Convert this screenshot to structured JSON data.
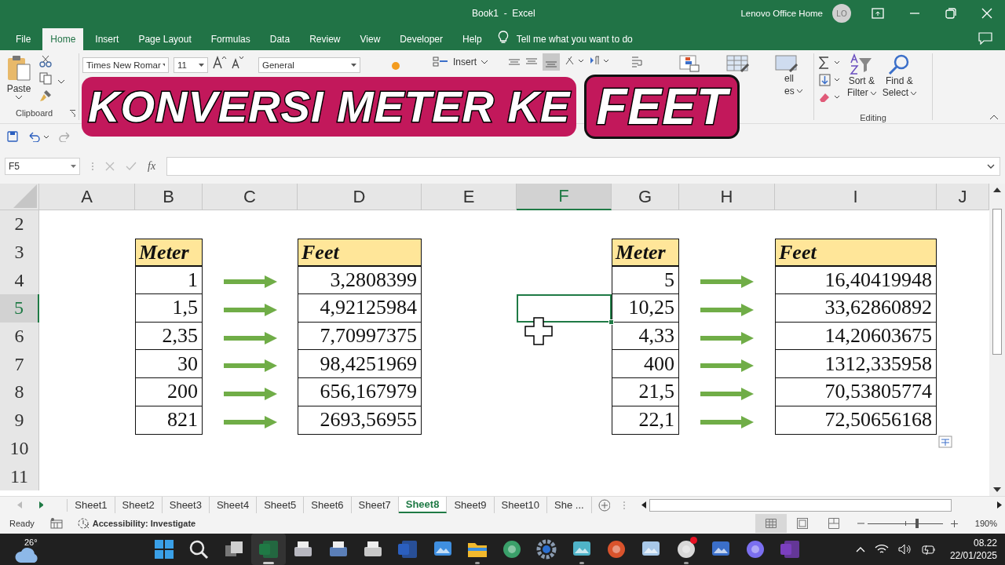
{
  "window": {
    "title": "Book1  -  Excel",
    "account": "Lenovo Office Home",
    "avatar": "LO"
  },
  "ribbon_tabs": [
    {
      "label": "File",
      "selected": false
    },
    {
      "label": "Home",
      "selected": true
    },
    {
      "label": "Insert",
      "selected": false
    },
    {
      "label": "Page Layout",
      "selected": false
    },
    {
      "label": "Formulas",
      "selected": false
    },
    {
      "label": "Data",
      "selected": false
    },
    {
      "label": "Review",
      "selected": false
    },
    {
      "label": "View",
      "selected": false
    },
    {
      "label": "Developer",
      "selected": false
    },
    {
      "label": "Help",
      "selected": false
    }
  ],
  "tell_me": {
    "placeholder": "Tell me what you want to do"
  },
  "ribbon": {
    "paste": "Paste",
    "clipboard_group": "Clipboard",
    "font_name": "Times New Romar",
    "font_size": "11",
    "number_format": "General",
    "insert": "Insert",
    "cell_styles_partial": [
      "ell",
      "es"
    ],
    "sort_filter": [
      "Sort &",
      "Filter"
    ],
    "find_select": [
      "Find &",
      "Select"
    ],
    "editing_group": "Editing"
  },
  "overlay_title": {
    "main": "KONVERSI METER KE",
    "highlight": "FEET"
  },
  "formula_bar": {
    "name_box": "F5",
    "fx": "fx"
  },
  "grid": {
    "columns": [
      {
        "label": "A",
        "selected": false
      },
      {
        "label": "B",
        "selected": false
      },
      {
        "label": "C",
        "selected": false
      },
      {
        "label": "D",
        "selected": false
      },
      {
        "label": "E",
        "selected": false
      },
      {
        "label": "F",
        "selected": true
      },
      {
        "label": "G",
        "selected": false
      },
      {
        "label": "H",
        "selected": false
      },
      {
        "label": "I",
        "selected": false
      },
      {
        "label": "J",
        "selected": false
      }
    ],
    "rows": [
      {
        "label": "2",
        "selected": false,
        "cells": [
          {
            "kind": "empty",
            "selected": false
          },
          {
            "kind": "empty",
            "selected": false
          },
          {
            "kind": "empty",
            "selected": false
          },
          {
            "kind": "empty",
            "selected": false
          },
          {
            "kind": "empty",
            "selected": false
          },
          {
            "kind": "empty",
            "selected": false
          },
          {
            "kind": "empty",
            "selected": false
          },
          {
            "kind": "empty",
            "selected": false
          },
          {
            "kind": "empty",
            "selected": false
          },
          {
            "kind": "empty",
            "selected": false
          }
        ]
      },
      {
        "label": "3",
        "selected": false,
        "cells": [
          {
            "kind": "empty",
            "selected": false
          },
          {
            "kind": "header",
            "text": "Meter",
            "selected": false
          },
          {
            "kind": "empty",
            "selected": false
          },
          {
            "kind": "header",
            "text": "Feet",
            "selected": false
          },
          {
            "kind": "empty",
            "selected": false
          },
          {
            "kind": "empty",
            "selected": false
          },
          {
            "kind": "header",
            "text": "Meter",
            "selected": false
          },
          {
            "kind": "empty",
            "selected": false
          },
          {
            "kind": "header",
            "text": "Feet",
            "selected": false
          },
          {
            "kind": "empty",
            "selected": false
          }
        ]
      },
      {
        "label": "4",
        "selected": false,
        "cells": [
          {
            "kind": "empty",
            "selected": false
          },
          {
            "kind": "number",
            "text": "1",
            "selected": false
          },
          {
            "kind": "arrow",
            "selected": false
          },
          {
            "kind": "number",
            "text": "3,2808399",
            "selected": false
          },
          {
            "kind": "empty",
            "selected": false
          },
          {
            "kind": "empty",
            "selected": false
          },
          {
            "kind": "number",
            "text": "5",
            "selected": false
          },
          {
            "kind": "arrow",
            "selected": false
          },
          {
            "kind": "number",
            "text": "16,40419948",
            "selected": false
          },
          {
            "kind": "empty",
            "selected": false
          }
        ]
      },
      {
        "label": "5",
        "selected": true,
        "cells": [
          {
            "kind": "empty",
            "selected": false
          },
          {
            "kind": "number",
            "text": "1,5",
            "selected": false
          },
          {
            "kind": "arrow",
            "selected": false
          },
          {
            "kind": "number",
            "text": "4,92125984",
            "selected": false
          },
          {
            "kind": "empty",
            "selected": false
          },
          {
            "kind": "empty",
            "selected": true
          },
          {
            "kind": "number",
            "text": "10,25",
            "selected": false
          },
          {
            "kind": "arrow",
            "selected": false
          },
          {
            "kind": "number",
            "text": "33,62860892",
            "selected": false
          },
          {
            "kind": "empty",
            "selected": false
          }
        ]
      },
      {
        "label": "6",
        "selected": false,
        "cells": [
          {
            "kind": "empty",
            "selected": false
          },
          {
            "kind": "number",
            "text": "2,35",
            "selected": false
          },
          {
            "kind": "arrow",
            "selected": false
          },
          {
            "kind": "number",
            "text": "7,70997375",
            "selected": false
          },
          {
            "kind": "empty",
            "selected": false
          },
          {
            "kind": "empty",
            "selected": false
          },
          {
            "kind": "number",
            "text": "4,33",
            "selected": false
          },
          {
            "kind": "arrow",
            "selected": false
          },
          {
            "kind": "number",
            "text": "14,20603675",
            "selected": false
          },
          {
            "kind": "empty",
            "selected": false
          }
        ]
      },
      {
        "label": "7",
        "selected": false,
        "cells": [
          {
            "kind": "empty",
            "selected": false
          },
          {
            "kind": "number",
            "text": "30",
            "selected": false
          },
          {
            "kind": "arrow",
            "selected": false
          },
          {
            "kind": "number",
            "text": "98,4251969",
            "selected": false
          },
          {
            "kind": "empty",
            "selected": false
          },
          {
            "kind": "empty",
            "selected": false
          },
          {
            "kind": "number",
            "text": "400",
            "selected": false
          },
          {
            "kind": "arrow",
            "selected": false
          },
          {
            "kind": "number",
            "text": "1312,335958",
            "selected": false
          },
          {
            "kind": "empty",
            "selected": false
          }
        ]
      },
      {
        "label": "8",
        "selected": false,
        "cells": [
          {
            "kind": "empty",
            "selected": false
          },
          {
            "kind": "number",
            "text": "200",
            "selected": false
          },
          {
            "kind": "arrow",
            "selected": false
          },
          {
            "kind": "number",
            "text": "656,167979",
            "selected": false
          },
          {
            "kind": "empty",
            "selected": false
          },
          {
            "kind": "empty",
            "selected": false
          },
          {
            "kind": "number",
            "text": "21,5",
            "selected": false
          },
          {
            "kind": "arrow",
            "selected": false
          },
          {
            "kind": "number",
            "text": "70,53805774",
            "selected": false
          },
          {
            "kind": "empty",
            "selected": false
          }
        ]
      },
      {
        "label": "9",
        "selected": false,
        "cells": [
          {
            "kind": "empty",
            "selected": false
          },
          {
            "kind": "number",
            "text": "821",
            "selected": false
          },
          {
            "kind": "arrow",
            "selected": false
          },
          {
            "kind": "number",
            "text": "2693,56955",
            "selected": false
          },
          {
            "kind": "empty",
            "selected": false
          },
          {
            "kind": "empty",
            "selected": false
          },
          {
            "kind": "number",
            "text": "22,1",
            "selected": false
          },
          {
            "kind": "arrow",
            "selected": false
          },
          {
            "kind": "number",
            "text": "72,50656168",
            "selected": false
          },
          {
            "kind": "empty",
            "selected": false
          }
        ]
      },
      {
        "label": "10",
        "selected": false,
        "cells": [
          {
            "kind": "empty",
            "selected": false
          },
          {
            "kind": "empty",
            "selected": false
          },
          {
            "kind": "empty",
            "selected": false
          },
          {
            "kind": "empty",
            "selected": false
          },
          {
            "kind": "empty",
            "selected": false
          },
          {
            "kind": "empty",
            "selected": false
          },
          {
            "kind": "empty",
            "selected": false
          },
          {
            "kind": "empty",
            "selected": false
          },
          {
            "kind": "empty",
            "selected": false
          },
          {
            "kind": "empty",
            "selected": false
          }
        ]
      },
      {
        "label": "11",
        "selected": false,
        "cells": [
          {
            "kind": "empty",
            "selected": false
          },
          {
            "kind": "empty",
            "selected": false
          },
          {
            "kind": "empty",
            "selected": false
          },
          {
            "kind": "empty",
            "selected": false
          },
          {
            "kind": "empty",
            "selected": false
          },
          {
            "kind": "empty",
            "selected": false
          },
          {
            "kind": "empty",
            "selected": false
          },
          {
            "kind": "empty",
            "selected": false
          },
          {
            "kind": "empty",
            "selected": false
          },
          {
            "kind": "empty",
            "selected": false
          }
        ]
      }
    ]
  },
  "sheet_tabs": [
    {
      "label": "Sheet1",
      "selected": false
    },
    {
      "label": "Sheet2",
      "selected": false
    },
    {
      "label": "Sheet3",
      "selected": false
    },
    {
      "label": "Sheet4",
      "selected": false
    },
    {
      "label": "Sheet5",
      "selected": false
    },
    {
      "label": "Sheet6",
      "selected": false
    },
    {
      "label": "Sheet7",
      "selected": false
    },
    {
      "label": "Sheet8",
      "selected": true
    },
    {
      "label": "Sheet9",
      "selected": false
    },
    {
      "label": "Sheet10",
      "selected": false
    },
    {
      "label": "She ...",
      "selected": false
    }
  ],
  "status_bar": {
    "mode": "Ready",
    "accessibility": "Accessibility: Investigate",
    "views": [
      {
        "kind": "normal",
        "selected": true
      },
      {
        "kind": "page-layout",
        "selected": false
      },
      {
        "kind": "page-break",
        "selected": false
      }
    ],
    "zoom": {
      "level": 0.66,
      "reading": "190%"
    }
  },
  "taskbar": {
    "weather": "26°",
    "apps": [
      {
        "kind": "start",
        "running": false,
        "selected": false
      },
      {
        "kind": "search",
        "running": false,
        "selected": false
      },
      {
        "kind": "taskview",
        "running": false,
        "selected": false
      },
      {
        "kind": "excel",
        "running": true,
        "selected": true
      },
      {
        "kind": "fax",
        "running": false,
        "selected": false
      },
      {
        "kind": "scanner",
        "running": false,
        "selected": false
      },
      {
        "kind": "printer",
        "running": false,
        "selected": false
      },
      {
        "kind": "word",
        "running": false,
        "selected": false
      },
      {
        "kind": "photos",
        "running": false,
        "selected": false
      },
      {
        "kind": "folder",
        "running": true,
        "selected": false
      },
      {
        "kind": "globe",
        "running": false,
        "selected": false
      },
      {
        "kind": "settings",
        "running": false,
        "selected": false
      },
      {
        "kind": "magnifier",
        "running": true,
        "selected": false
      },
      {
        "kind": "powerpoint",
        "running": false,
        "selected": false
      },
      {
        "kind": "monitor",
        "running": false,
        "selected": false
      },
      {
        "kind": "obs",
        "running": true,
        "selected": false
      },
      {
        "kind": "remote",
        "running": false,
        "selected": false
      },
      {
        "kind": "copilot",
        "running": false,
        "selected": false
      },
      {
        "kind": "onenote",
        "running": false,
        "selected": false
      }
    ],
    "time": "08.22",
    "date": "22/01/2025"
  }
}
